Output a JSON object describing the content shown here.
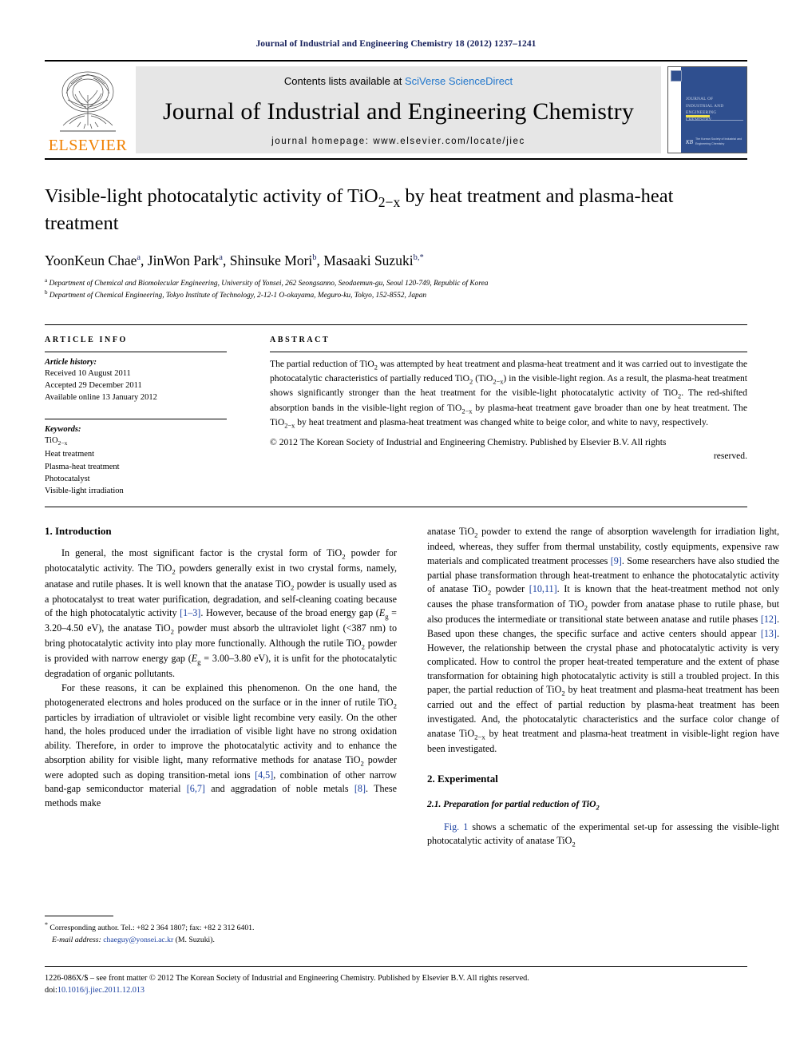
{
  "running_head": "Journal of Industrial and Engineering Chemistry 18 (2012) 1237–1241",
  "masthead": {
    "contents_prefix": "Contents lists available at ",
    "sciencedirect": "SciVerse ScienceDirect",
    "journal_name": "Journal of Industrial and Engineering Chemistry",
    "homepage": "journal homepage: www.elsevier.com/locate/jiec",
    "publisher_wordmark": "ELSEVIER",
    "cover": {
      "title_lines": "Journal of Industrial and Engineering Chemistry",
      "society_mark": "KB",
      "society_text": "The Korean Society of Industrial and Engineering Chemistry"
    }
  },
  "article": {
    "title_part1": "Visible-light photocatalytic activity of TiO",
    "title_sub": "2−x",
    "title_part2": " by heat treatment and plasma-heat treatment",
    "authors_html": "YoonKeun Chae a, JinWon Park a, Shinsuke Mori b, Masaaki Suzuki b,*",
    "affiliation_a": "Department of Chemical and Biomolecular Engineering, University of Yonsei, 262 Seongsanno, Seodaemun-gu, Seoul 120-749, Republic of Korea",
    "affiliation_b": "Department of Chemical Engineering, Tokyo Institute of Technology, 2-12-1 O-okayama, Meguro-ku, Tokyo, 152-8552, Japan"
  },
  "info": {
    "label": "ARTICLE INFO",
    "history_head": "Article history:",
    "received": "Received 10 August 2011",
    "accepted": "Accepted 29 December 2011",
    "available": "Available online 13 January 2012",
    "keywords_head": "Keywords:",
    "keywords": [
      "TiO2−x",
      "Heat treatment",
      "Plasma-heat treatment",
      "Photocatalyst",
      "Visible-light irradiation"
    ]
  },
  "abstract": {
    "label": "ABSTRACT",
    "text": "The partial reduction of TiO2 was attempted by heat treatment and plasma-heat treatment and it was carried out to investigate the photocatalytic characteristics of partially reduced TiO2 (TiO2−x) in the visible-light region. As a result, the plasma-heat treatment shows significantly stronger than the heat treatment for the visible-light photocatalytic activity of TiO2. The red-shifted absorption bands in the visible-light region of TiO2−x by plasma-heat treatment gave broader than one by heat treatment. The TiO2−x by heat treatment and plasma-heat treatment was changed white to beige color, and white to navy, respectively.",
    "copyright": "© 2012 The Korean Society of Industrial and Engineering Chemistry. Published by Elsevier B.V. All rights",
    "copyright_tail": "reserved."
  },
  "sections": {
    "introduction_heading": "1. Introduction",
    "experimental_heading": "2. Experimental",
    "experimental_sub_heading": "2.1. Preparation for partial reduction of TiO2"
  },
  "body": {
    "left_p1": "In general, the most significant factor is the crystal form of TiO2 powder for photocatalytic activity. The TiO2 powders generally exist in two crystal forms, namely, anatase and rutile phases. It is well known that the anatase TiO2 powder is usually used as a photocatalyst to treat water purification, degradation, and self-cleaning coating because of the high photocatalytic activity [1–3]. However, because of the broad energy gap (Eg = 3.20–4.50 eV), the anatase TiO2 powder must absorb the ultraviolet light (<387 nm) to bring photocatalytic activity into play more functionally. Although the rutile TiO2 powder is provided with narrow energy gap (Eg = 3.00–3.80 eV), it is unfit for the photocatalytic degradation of organic pollutants.",
    "left_p2": "For these reasons, it can be explained this phenomenon. On the one hand, the photogenerated electrons and holes produced on the surface or in the inner of rutile TiO2 particles by irradiation of ultraviolet or visible light recombine very easily. On the other hand, the holes produced under the irradiation of visible light have no strong oxidation ability. Therefore, in order to improve the photocatalytic activity and to enhance the absorption ability for visible light, many reformative methods for anatase TiO2 powder were adopted such as doping transition-metal ions [4,5], combination of other narrow band-gap semiconductor material [6,7] and aggradation of noble metals [8]. These methods make",
    "right_p1": "anatase TiO2 powder to extend the range of absorption wavelength for irradiation light, indeed, whereas, they suffer from thermal unstability, costly equipments, expensive raw materials and complicated treatment processes [9]. Some researchers have also studied the partial phase transformation through heat-treatment to enhance the photocatalytic activity of anatase TiO2 powder [10,11]. It is known that the heat-treatment method not only causes the phase transformation of TiO2 powder from anatase phase to rutile phase, but also produces the intermediate or transitional state between anatase and rutile phases [12]. Based upon these changes, the specific surface and active centers should appear [13]. However, the relationship between the crystal phase and photocatalytic activity is very complicated. How to control the proper heat-treated temperature and the extent of phase transformation for obtaining high photocatalytic activity is still a troubled project. In this paper, the partial reduction of TiO2 by heat treatment and plasma-heat treatment has been carried out and the effect of partial reduction by plasma-heat treatment has been investigated. And, the photocatalytic characteristics and the surface color change of anatase TiO2−x by heat treatment and plasma-heat treatment in visible-light region have been investigated.",
    "right_p2": "Fig. 1 shows a schematic of the experimental set-up for assessing the visible-light photocatalytic activity of anatase TiO2"
  },
  "footnote": {
    "star": "*",
    "corresponding": "Corresponding author. Tel.: +82 2 364 1807; fax: +82 2 312 6401.",
    "email_label": "E-mail address:",
    "email": "chaeguy@yonsei.ac.kr",
    "email_owner": "(M. Suzuki)."
  },
  "page_footer": {
    "issn_line": "1226-086X/$ – see front matter © 2012 The Korean Society of Industrial and Engineering Chemistry. Published by Elsevier B.V. All rights reserved.",
    "doi_prefix": "doi:",
    "doi": "10.1016/j.jiec.2011.12.013"
  },
  "colors": {
    "header_blue": "#141e5a",
    "link_blue": "#1a3fa0",
    "sciencedirect_blue": "#2277cc",
    "elsevier_orange": "#f08000",
    "cover_blue": "#2f4f8f",
    "contents_gray": "#e6e6e6"
  }
}
